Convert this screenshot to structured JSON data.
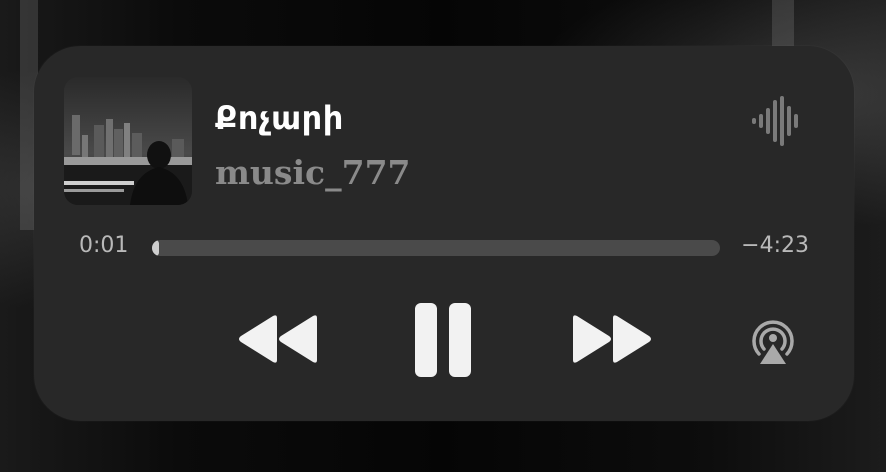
{
  "track": {
    "title": "Քոչարի",
    "artist": "music_777"
  },
  "playback": {
    "elapsed": "0:01",
    "remaining": "−4:23",
    "progress": 0.004,
    "state": "playing"
  },
  "controls": {
    "rewind_icon": "rewind-icon",
    "pause_icon": "pause-icon",
    "forward_icon": "fast-forward-icon",
    "airplay_icon": "airplay-icon",
    "waveform_icon": "audio-waveform-icon"
  },
  "colors": {
    "card_background": "#282828",
    "title_text": "#ffffff",
    "artist_text": "#8a8a8a",
    "track_background": "#4a4a4a",
    "control_icons": "#f2f2f2"
  }
}
